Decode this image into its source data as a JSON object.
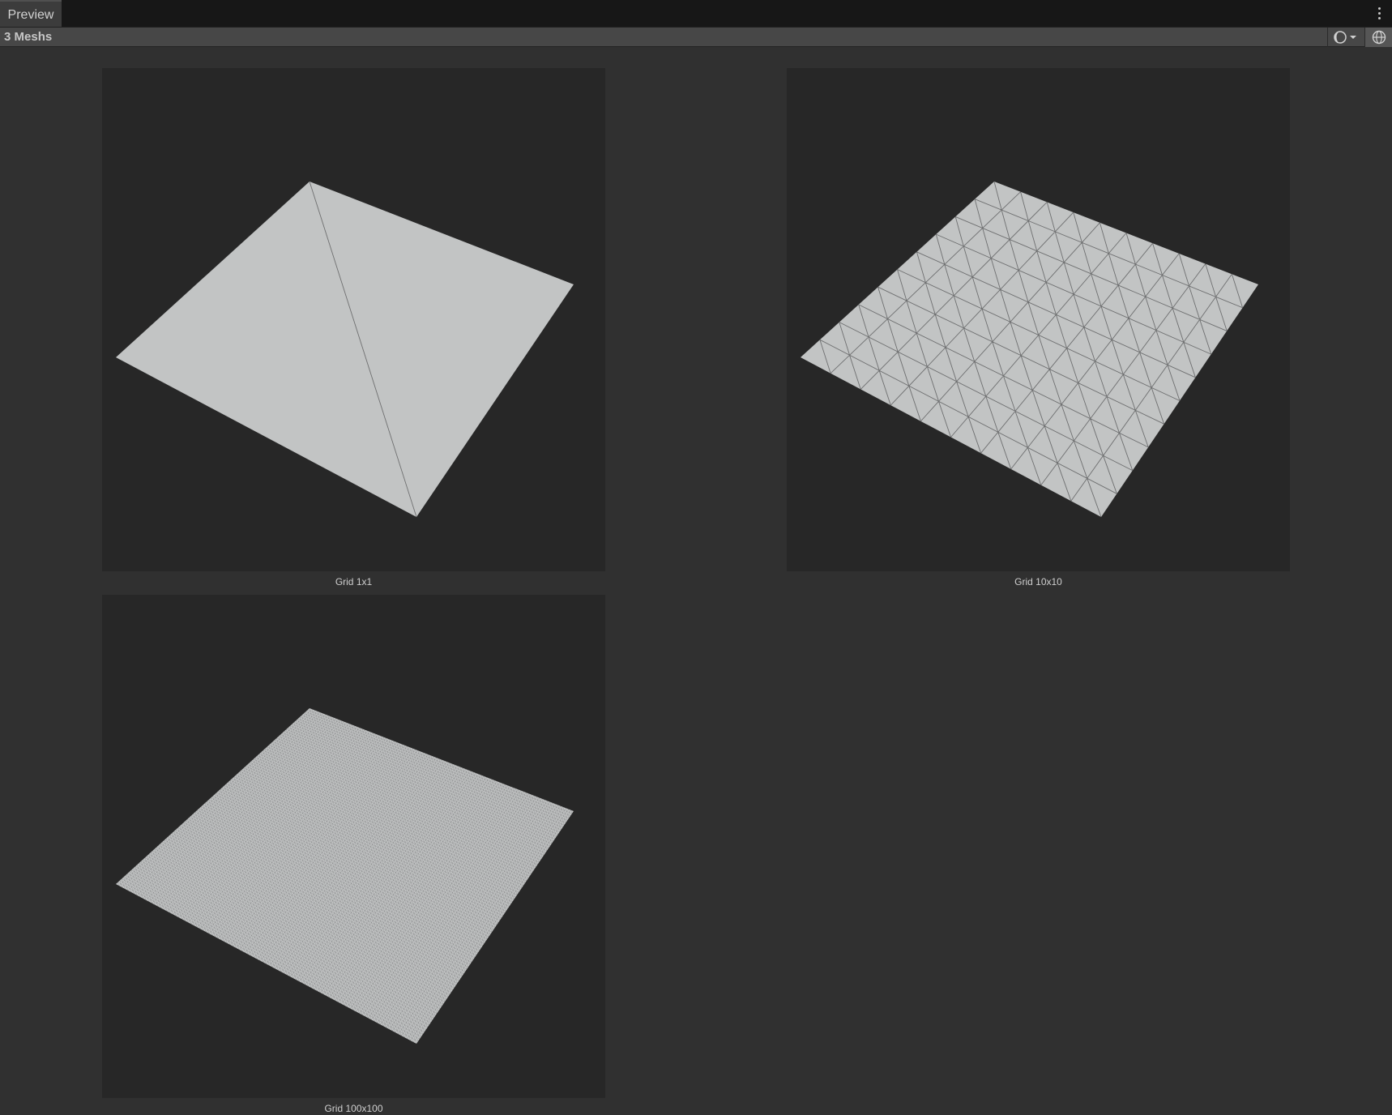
{
  "window": {
    "tab_label": "Preview"
  },
  "toolbar": {
    "title": "3 Meshs"
  },
  "previews": [
    {
      "label": "Grid 1x1",
      "grid": 1
    },
    {
      "label": "Grid 10x10",
      "grid": 10
    },
    {
      "label": "Grid 100x100",
      "grid": 100
    }
  ],
  "colors": {
    "panel_bg": "#303030",
    "viewport_bg": "#272727",
    "mesh_fill": "#c2c4c4",
    "wire": "#6e6f70"
  }
}
